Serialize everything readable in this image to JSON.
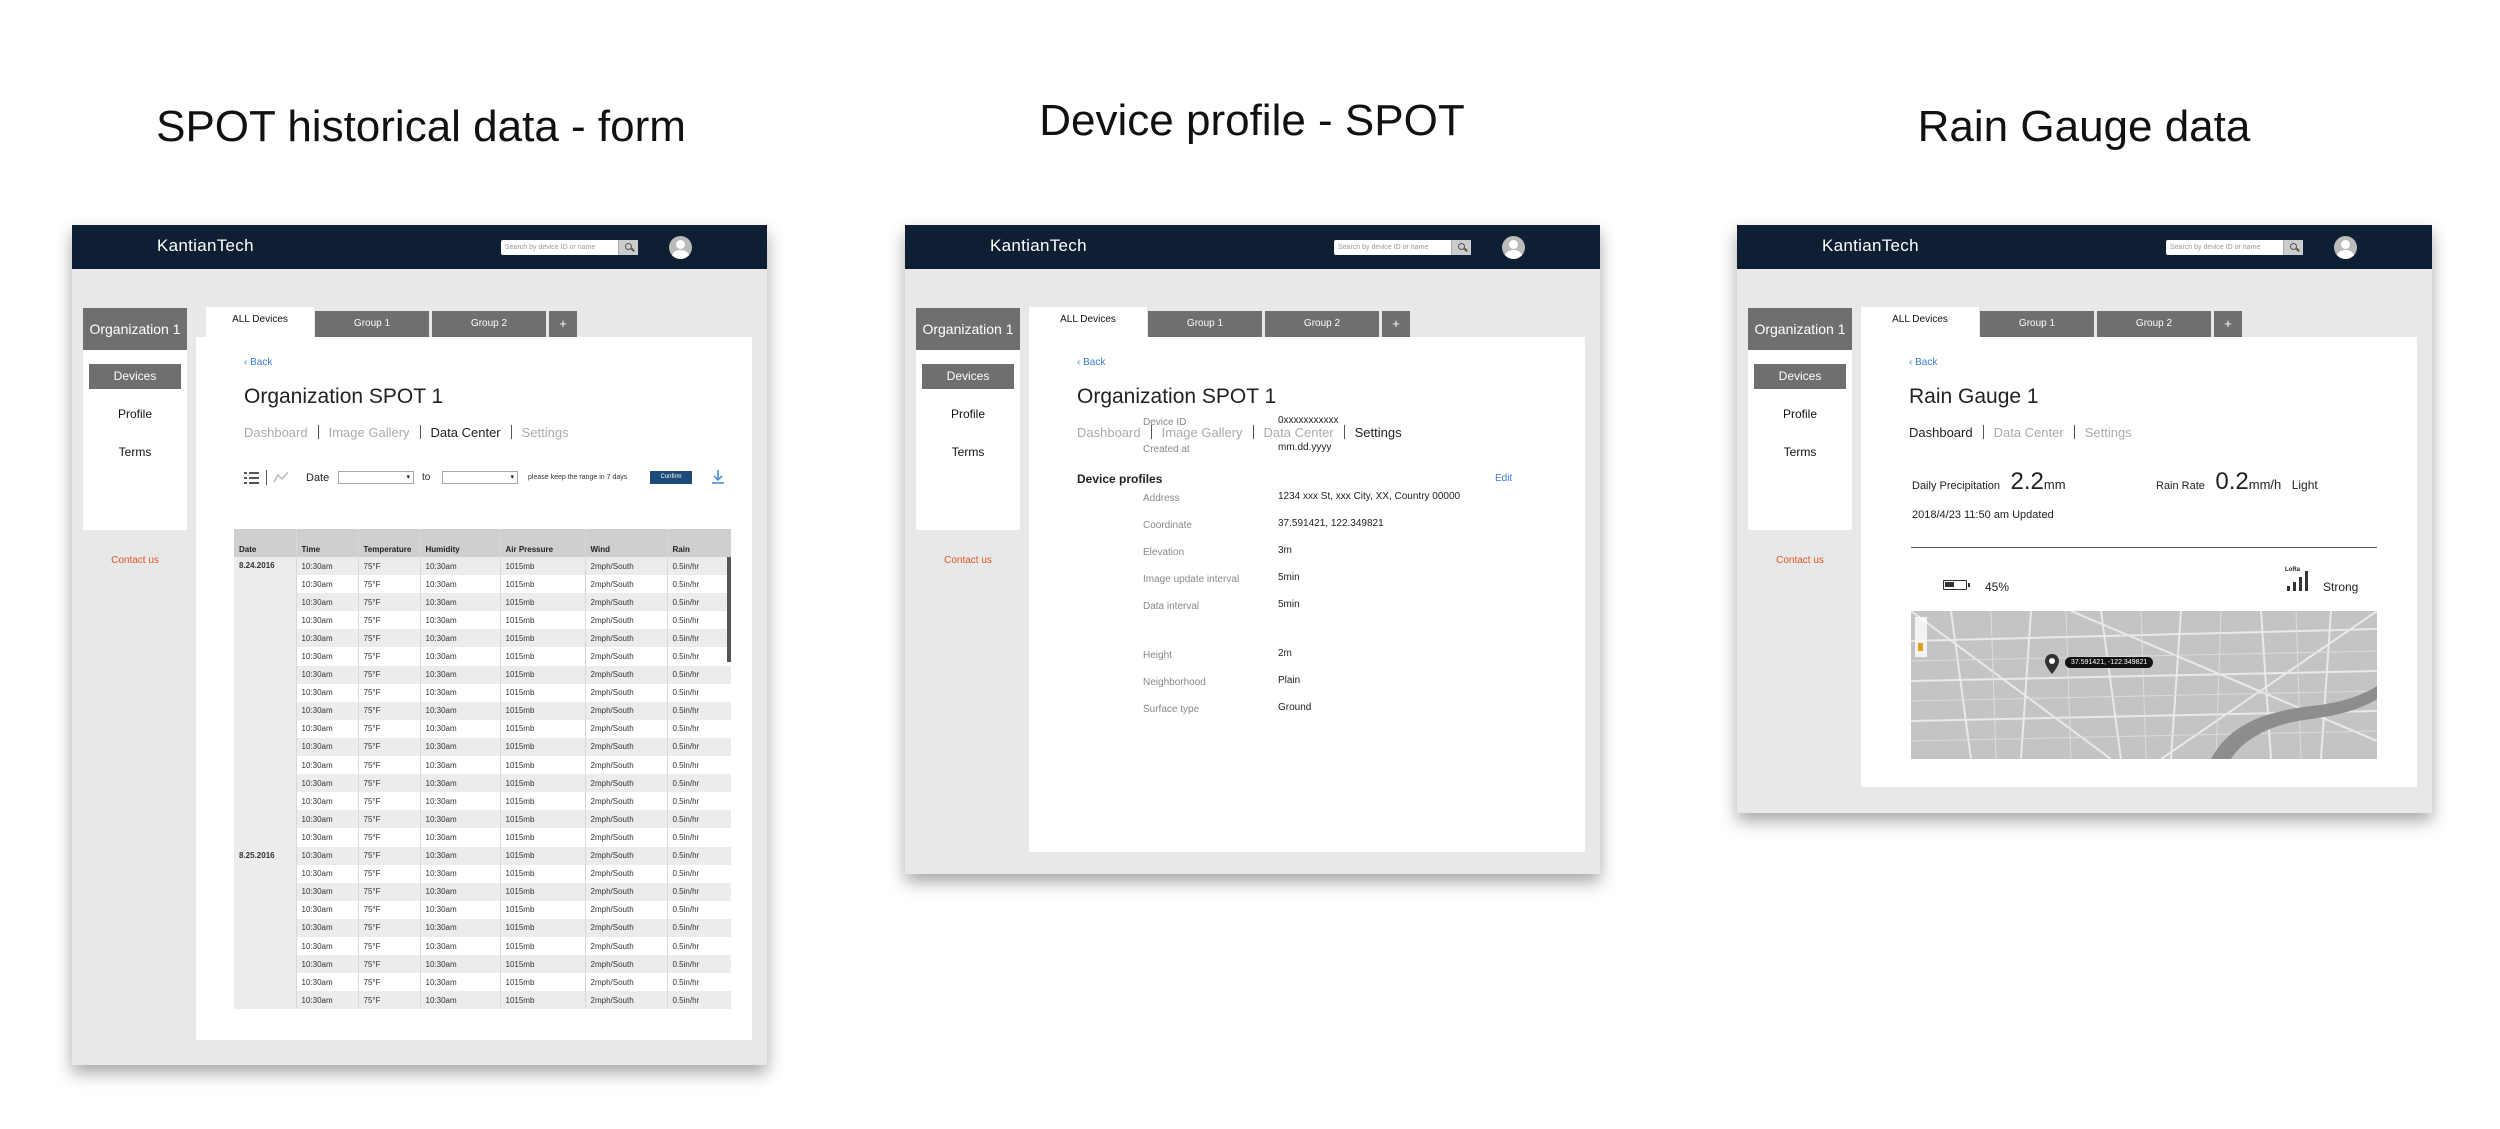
{
  "headings": [
    "SPOT historical data - form",
    "Device profile - SPOT",
    "Rain Gauge data"
  ],
  "common": {
    "brand": "KantianTech",
    "search_placeholder": "Search by device ID or name",
    "org": "Organization 1",
    "sidebar": [
      "Devices",
      "Profile",
      "Terms"
    ],
    "contact": "Contact us",
    "tabs": [
      "ALL Devices",
      "Group 1",
      "Group 2",
      "+"
    ],
    "back": "Back"
  },
  "screen1": {
    "title": "Organization SPOT 1",
    "subnav": [
      "Dashboard",
      "Image Gallery",
      "Data Center",
      "Settings"
    ],
    "active_subnav": "Data Center",
    "filter": {
      "date_label": "Date",
      "to_label": "to",
      "hint": "please keep the range in 7 days",
      "confirm": "Confirm"
    },
    "table": {
      "columns": [
        "Date",
        "Time",
        "Temperature",
        "Humidity",
        "Air Pressure",
        "Wind",
        "Rain"
      ],
      "groups": [
        {
          "date": "8.24.2016",
          "rows": 16
        },
        {
          "date": "8.25.2016",
          "rows": 9
        }
      ],
      "row": [
        "10:30am",
        "75°F",
        "10:30am",
        "1015mb",
        "2mph/South",
        "0.5in/hr"
      ]
    }
  },
  "screen2": {
    "title": "Organization SPOT 1",
    "subnav": [
      "Dashboard",
      "Image Gallery",
      "Data Center",
      "Settings"
    ],
    "active_subnav": "Settings",
    "section": "Device profiles",
    "edit": "Edit",
    "fields": [
      {
        "label": "Device ID",
        "value": "0xxxxxxxxxxx"
      },
      {
        "label": "Created at",
        "value": "mm.dd.yyyy"
      },
      {
        "label": "Address",
        "value": "1234 xxx St, xxx City, XX, Country 00000"
      },
      {
        "label": "Coordinate",
        "value": "37.591421, 122.349821"
      },
      {
        "label": "Elevation",
        "value": "3m"
      },
      {
        "label": "Image update interval",
        "value": "5min"
      },
      {
        "label": "Data interval",
        "value": "5min"
      },
      {
        "label": "Height",
        "value": "2m"
      },
      {
        "label": "Neighborhood",
        "value": "Plain"
      },
      {
        "label": "Surface type",
        "value": "Ground"
      }
    ]
  },
  "screen3": {
    "title": "Rain Gauge 1",
    "subnav": [
      "Dashboard",
      "Data Center",
      "Settings"
    ],
    "active_subnav": "Dashboard",
    "precip_label": "Daily Precipitation",
    "precip_value": "2.2",
    "precip_unit": "mm",
    "rate_label": "Rain Rate",
    "rate_value": "0.2",
    "rate_unit": "mm/h",
    "rate_desc": "Light",
    "updated": "2018/4/23 11:50 am Updated",
    "battery": "45%",
    "battery_level": 0.45,
    "signal_tag": "LoRa",
    "signal": "Strong",
    "map_pin": "37.591421, -122.349821"
  }
}
